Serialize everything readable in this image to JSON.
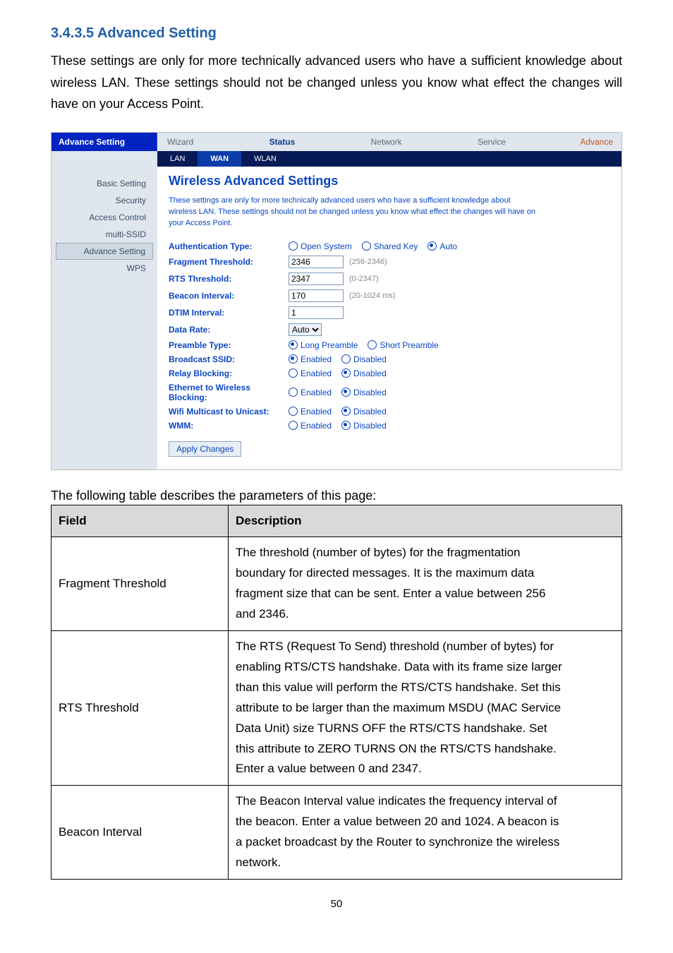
{
  "section_number": "3.4.3.5 Advanced Setting",
  "intro_text": "These settings are only for more technically advanced users who have a sufficient knowledge about wireless LAN. These settings should not be changed unless you know what effect the changes will have on your Access Point.",
  "page_number": "50",
  "shot": {
    "title": "Advance Setting",
    "topnav": {
      "wizard": "Wizard",
      "status": "Status",
      "network": "Network",
      "service": "Service",
      "advance": "Advance"
    },
    "subtabs": {
      "lan": "LAN",
      "wan": "WAN",
      "wlan": "WLAN"
    },
    "sidebar": {
      "basic_setting": "Basic Setting",
      "security": "Security",
      "access_control": "Access Control",
      "multi_ssid": "multi-SSID",
      "advance_setting": "Advance Setting",
      "wps": "WPS"
    },
    "heading": "Wireless Advanced Settings",
    "note": "These settings are only for more technically advanced users who have a sufficient knowledge about wireless LAN. These settings should not be changed unless you know what effect the changes will have on your Access Point.",
    "rows": {
      "auth": {
        "label": "Authentication Type:",
        "opts": {
          "open": "Open System",
          "shared": "Shared Key",
          "auto": "Auto"
        }
      },
      "frag": {
        "label": "Fragment Threshold:",
        "value": "2346",
        "hint": "(256-2346)"
      },
      "rts": {
        "label": "RTS Threshold:",
        "value": "2347",
        "hint": "(0-2347)"
      },
      "beacon": {
        "label": "Beacon Interval:",
        "value": "170",
        "hint": "(20-1024 ms)"
      },
      "dtim": {
        "label": "DTIM Interval:",
        "value": "1"
      },
      "rate": {
        "label": "Data Rate:",
        "value": "Auto"
      },
      "preamble": {
        "label": "Preamble Type:",
        "long": "Long Preamble",
        "short": "Short Preamble"
      },
      "ssid": {
        "label": "Broadcast SSID:"
      },
      "relay": {
        "label": "Relay Blocking:"
      },
      "eth": {
        "label": "Ethernet to Wireless Blocking:"
      },
      "wifi": {
        "label": "Wifi Multicast to Unicast:"
      },
      "wmm": {
        "label": "WMM:"
      },
      "enabled": "Enabled",
      "disabled": "Disabled"
    },
    "apply_button": "Apply Changes"
  },
  "table": {
    "caption": "The following table describes the parameters of this page:",
    "head": {
      "field": "Field",
      "desc": "Description"
    },
    "frag": {
      "field": "Fragment Threshold",
      "d1": "The threshold (number of bytes) for the fragmentation",
      "d2": "boundary for directed messages. It is the maximum data",
      "d3": "fragment size that can be sent. Enter a value between 256",
      "d4": "and 2346."
    },
    "rts": {
      "field": "RTS Threshold",
      "d1": "The RTS (Request To Send) threshold (number of bytes) for",
      "d2": "enabling RTS/CTS handshake. Data with its frame size larger",
      "d3": "than this value will perform the RTS/CTS handshake. Set this",
      "d4": "attribute to be larger than the maximum MSDU (MAC Service",
      "d5": "Data Unit) size TURNS OFF the RTS/CTS handshake. Set",
      "d6": "this attribute to ZERO TURNS ON the RTS/CTS handshake.",
      "d7": "Enter a value between 0 and 2347."
    },
    "beacon": {
      "field": "Beacon Interval",
      "d1": "The Beacon Interval value indicates the frequency interval of",
      "d2": "the beacon. Enter a value between 20 and 1024. A beacon is",
      "d3": "a packet broadcast by the Router to synchronize the wireless",
      "d4": "network."
    }
  }
}
